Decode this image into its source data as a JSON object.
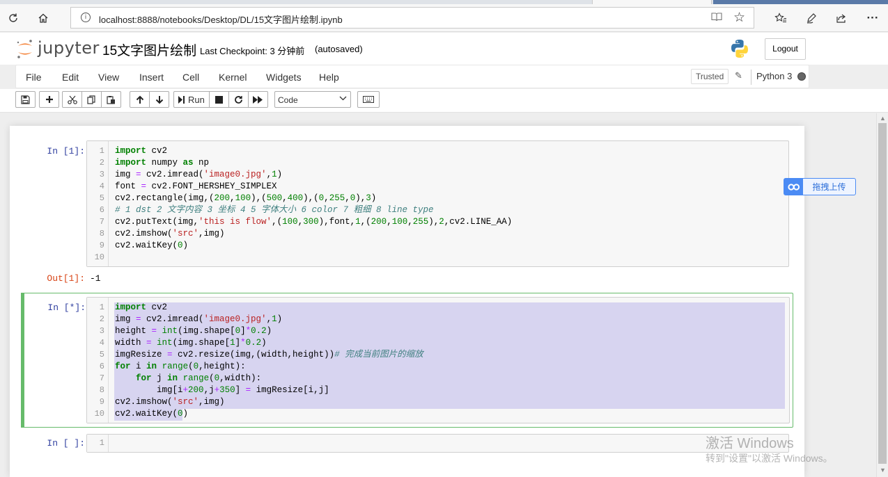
{
  "browser": {
    "url": "localhost:8888/notebooks/Desktop/DL/15文字图片绘制.ipynb",
    "icons": [
      "refresh-icon",
      "home-icon",
      "info-icon",
      "reader-view-icon",
      "favorite-star-icon",
      "favorites-list-icon",
      "pen-icon",
      "share-icon",
      "more-icon"
    ],
    "more_label": "···"
  },
  "header": {
    "logo_text": "jupyter",
    "notebook_title": "15文字图片绘制",
    "checkpoint": "Last Checkpoint: 3 分钟前",
    "autosave": "(autosaved)",
    "logout_label": "Logout"
  },
  "menu": {
    "items": [
      "File",
      "Edit",
      "View",
      "Insert",
      "Cell",
      "Kernel",
      "Widgets",
      "Help"
    ],
    "trusted": "Trusted",
    "kernel": "Python 3"
  },
  "toolbar": {
    "run_label": "Run",
    "cell_type": "Code"
  },
  "cells": [
    {
      "prompt": "In [1]:",
      "line_numbers": [
        "1",
        "2",
        "3",
        "4",
        "5",
        "6",
        "7",
        "8",
        "9",
        "10"
      ],
      "lines": [
        "import cv2",
        "import numpy as np",
        "img = cv2.imread('image0.jpg',1)",
        "font = cv2.FONT_HERSHEY_SIMPLEX",
        "cv2.rectangle(img,(200,100),(500,400),(0,255,0),3)",
        "# 1 dst 2 文字内容 3 坐标 4 5 字体大小 6 color 7 粗细 8 line type",
        "cv2.putText(img,'this is flow',(100,300),font,1,(200,100,255),2,cv2.LINE_AA)",
        "cv2.imshow('src',img)",
        "cv2.waitKey(0)",
        ""
      ],
      "out_prompt": "Out[1]:",
      "output": "-1"
    },
    {
      "prompt": "In [*]:",
      "line_numbers": [
        "1",
        "2",
        "3",
        "4",
        "5",
        "6",
        "7",
        "8",
        "9",
        "10"
      ],
      "lines": [
        "import cv2",
        "img = cv2.imread('image0.jpg',1)",
        "height = int(img.shape[0]*0.2)",
        "width = int(img.shape[1]*0.2)",
        "imgResize = cv2.resize(img,(width,height))# 完成当前图片的缩放",
        "for i in range(0,height):",
        "    for j in range(0,width):",
        "        img[i+200,j+350] = imgResize[i,j]",
        "cv2.imshow('src',img)",
        "cv2.waitKey(0)"
      ]
    },
    {
      "prompt": "In [ ]:",
      "line_numbers": [
        "1"
      ]
    }
  ],
  "extension": {
    "upload_label": "拖拽上传"
  },
  "watermark": {
    "line1": "激活 Windows",
    "line2": "转到\"设置\"以激活 Windows。"
  },
  "colors": {
    "selected_cell": "#66bb6a",
    "in_prompt": "#303f9f",
    "out_prompt": "#d84315",
    "selection": "#d7d4f0",
    "extension_accent": "#4b8bf4"
  }
}
